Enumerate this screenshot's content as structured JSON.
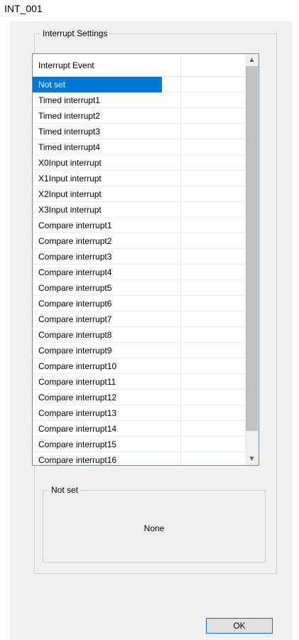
{
  "window": {
    "title": "INT_001"
  },
  "interrupt_settings": {
    "group_label": "Interrupt Settings",
    "column_header": "Interrupt Event",
    "selected_index": 0,
    "items": [
      "Not set",
      "Timed interrupt1",
      "Timed interrupt2",
      "Timed interrupt3",
      "Timed interrupt4",
      "X0Input interrupt",
      "X1Input interrupt",
      "X2Input interrupt",
      "X3Input interrupt",
      "Compare interrupt1",
      "Compare interrupt2",
      "Compare interrupt3",
      "Compare interrupt4",
      "Compare interrupt5",
      "Compare interrupt6",
      "Compare interrupt7",
      "Compare interrupt8",
      "Compare interrupt9",
      "Compare interrupt10",
      "Compare interrupt11",
      "Compare interrupt12",
      "Compare interrupt13",
      "Compare interrupt14",
      "Compare interrupt15",
      "Compare interrupt16"
    ]
  },
  "detail": {
    "group_label": "Not set",
    "value": "None"
  },
  "buttons": {
    "ok_label": "OK"
  },
  "scrollbar": {
    "up_icon": "▲",
    "down_icon": "▼"
  },
  "colors": {
    "selection": "#0078d7",
    "dialog_bg": "#f0f0f0"
  }
}
